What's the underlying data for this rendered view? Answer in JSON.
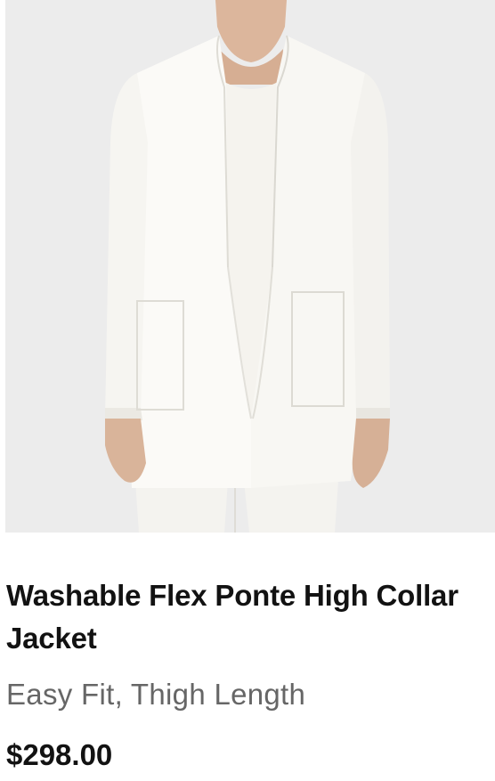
{
  "product": {
    "image_name": "product-photo",
    "title": "Washable Flex Ponte High Collar Jacket",
    "subtitle": "Easy Fit, Thigh Length",
    "price": "$298.00"
  },
  "colors": {
    "background": "#ececec",
    "garment": "#f7f6f2",
    "skin": "#d9b49a",
    "title_text": "#121212",
    "subtitle_text": "#666666"
  }
}
